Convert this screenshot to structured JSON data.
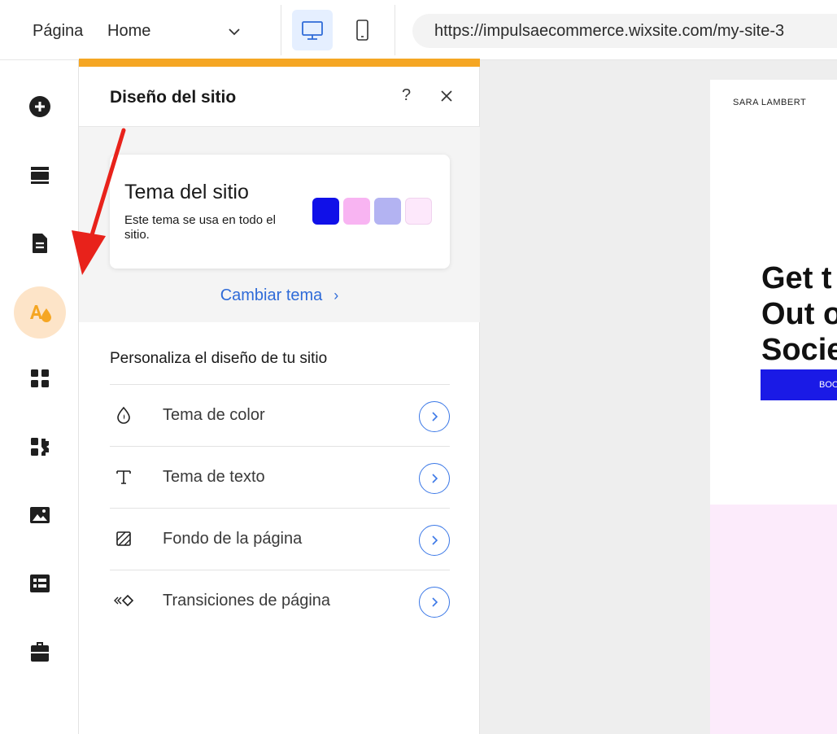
{
  "topbar": {
    "page_label": "Página",
    "page_value": "Home",
    "url": "https://impulsaecommerce.wixsite.com/my-site-3"
  },
  "rail": {
    "items": [
      {
        "icon": "add-icon"
      },
      {
        "icon": "sections-icon"
      },
      {
        "icon": "pages-icon"
      },
      {
        "icon": "site-design-icon",
        "active": true
      },
      {
        "icon": "apps-icon"
      },
      {
        "icon": "add-apps-icon"
      },
      {
        "icon": "media-icon"
      },
      {
        "icon": "cms-icon"
      },
      {
        "icon": "business-icon"
      }
    ]
  },
  "panel": {
    "title": "Diseño del sitio",
    "help": "?",
    "theme_card": {
      "title": "Tema del sitio",
      "description": "Este tema se usa en todo el sitio.",
      "swatches": [
        "#1010e8",
        "#f8b4f2",
        "#b3b3f2",
        "#fde8fb"
      ]
    },
    "change_theme": "Cambiar tema",
    "customize_title": "Personaliza el diseño de tu sitio",
    "options": [
      {
        "label": "Tema de color",
        "icon": "color-drop-icon"
      },
      {
        "label": "Tema de texto",
        "icon": "text-icon"
      },
      {
        "label": "Fondo de la página",
        "icon": "background-icon"
      },
      {
        "label": "Transiciones de página",
        "icon": "transitions-icon"
      }
    ]
  },
  "site_preview": {
    "brand": "SARA LAMBERT",
    "hero_lines": [
      "Get t",
      "Out o",
      "Socie"
    ],
    "button": "BOO"
  },
  "colors": {
    "accent": "#f5a623",
    "link": "#2f6bd8",
    "active_rail": "#fde4c8",
    "annotation": "#e8221b"
  }
}
